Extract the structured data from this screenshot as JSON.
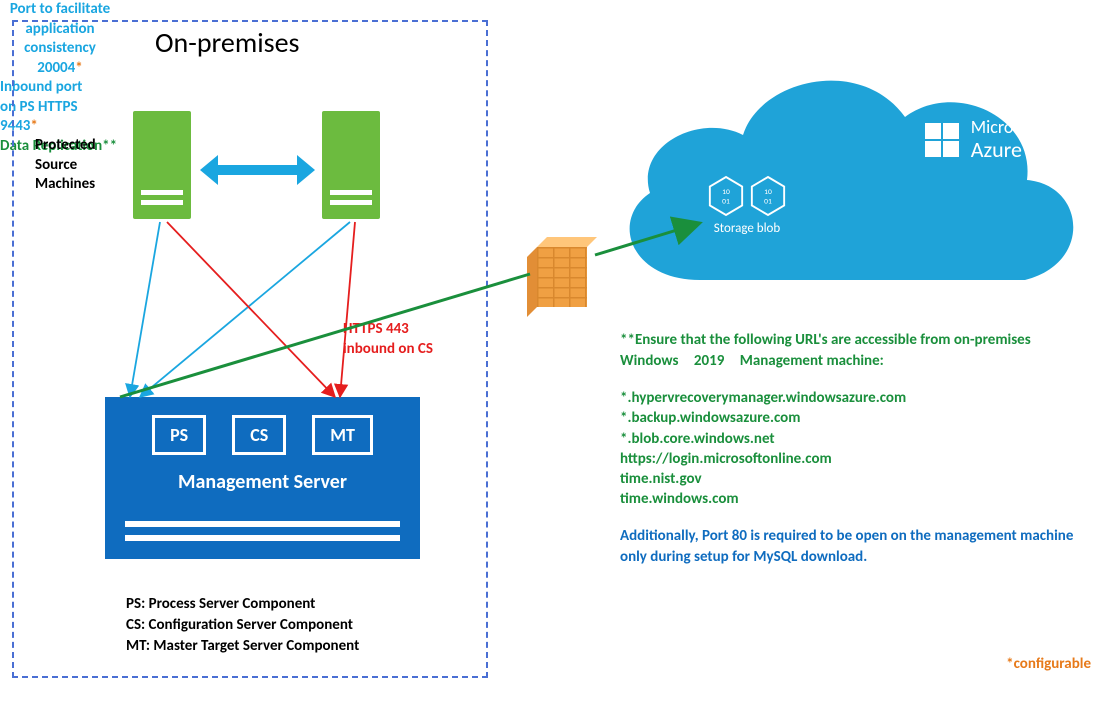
{
  "onprem": {
    "title": "On-premises",
    "protected_label": "Protected\nSource\nMachines",
    "port_20004": "Port to facilitate\napplication\nconsistency\n20004",
    "port_20004_ast": "*",
    "port_9443": "Inbound port\non PS HTTPS\n9443",
    "port_9443_ast": "*",
    "https_443": "HTTPS 443\ninbound on CS",
    "mgmt": {
      "ps": "PS",
      "cs": "CS",
      "mt": "MT",
      "title": "Management Server"
    },
    "legend": {
      "ps": "PS: Process Server Component",
      "cs": "CS: Configuration Server Component",
      "mt": "MT: Master Target Server Component"
    },
    "configurable": "*configurable"
  },
  "data_replication": "Data Replication**",
  "azure": {
    "brand_top": "Microsoft",
    "brand_bot": "Azure",
    "storage_blob": "Storage blob"
  },
  "right": {
    "ensure": "**Ensure that the following URL's are accessible from on-premises Windows",
    "ensure_ver": "2019",
    "ensure_tail": "Management machine:",
    "urls": [
      "*.hypervrecoverymanager.windowsazure.com",
      "*.backup.windowsazure.com",
      "*.blob.core.windows.net",
      "https://login.microsoftonline.com",
      "time.nist.gov",
      "time.windows.com"
    ],
    "additional": "Additionally, Port 80 is required to be open on the management machine only during setup for MySQL download."
  }
}
